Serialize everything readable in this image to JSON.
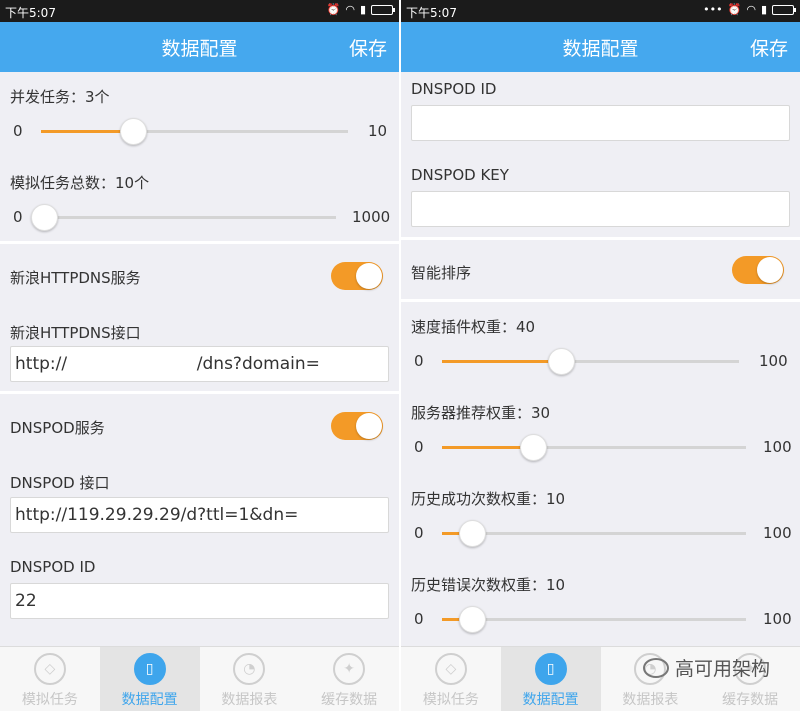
{
  "accent_color": "#45a8ee",
  "slider_color": "#f39a27",
  "left": {
    "status": {
      "time": "下午5:07",
      "icons": [
        "alarm-icon",
        "wifi-icon",
        "signal-icon",
        "battery-icon"
      ]
    },
    "title": "数据配置",
    "save": "保存",
    "concurrent": {
      "label": "并发任务：3个",
      "min": "0",
      "max": "10",
      "value": 3,
      "range": [
        0,
        10
      ]
    },
    "total": {
      "label": "模拟任务总数：10个",
      "min": "0",
      "max": "1000",
      "value": 10,
      "range": [
        0,
        1000
      ]
    },
    "sina_service": {
      "label": "新浪HTTPDNS服务",
      "enabled": true
    },
    "sina_endpoint": {
      "label": "新浪HTTPDNS接口",
      "value": "http://                        /dns?domain="
    },
    "dnspod_service": {
      "label": "DNSPOD服务",
      "enabled": true
    },
    "dnspod_endpoint": {
      "label": "DNSPOD 接口",
      "value": "http://119.29.29.29/d?ttl=1&dn="
    },
    "dnspod_id": {
      "label": "DNSPOD ID",
      "value": "22"
    }
  },
  "right": {
    "status": {
      "time": "下午5:07",
      "icons": [
        "more-icon",
        "alarm-icon",
        "wifi-icon",
        "signal-icon",
        "battery-icon"
      ]
    },
    "title": "数据配置",
    "save": "保存",
    "dnspod_id": {
      "label": "DNSPOD ID",
      "value": ""
    },
    "dnspod_key": {
      "label": "DNSPOD KEY",
      "value": ""
    },
    "smart_sort": {
      "label": "智能排序",
      "enabled": true
    },
    "speed_weight": {
      "label": "速度插件权重：40",
      "min": "0",
      "max": "100",
      "value": 40,
      "range": [
        0,
        100
      ]
    },
    "server_weight": {
      "label": "服务器推荐权重：30",
      "min": "0",
      "max": "100",
      "value": 30,
      "range": [
        0,
        100
      ]
    },
    "success_weight": {
      "label": "历史成功次数权重：10",
      "min": "0",
      "max": "100",
      "value": 10,
      "range": [
        0,
        100
      ]
    },
    "error_weight": {
      "label": "历史错误次数权重：10",
      "min": "0",
      "max": "100",
      "value": 10,
      "range": [
        0,
        100
      ]
    }
  },
  "tabs": [
    {
      "label": "模拟任务",
      "icon": "tag-icon",
      "active": false
    },
    {
      "label": "数据配置",
      "icon": "bookmark-icon",
      "active": true
    },
    {
      "label": "数据报表",
      "icon": "pie-chart-icon",
      "active": false
    },
    {
      "label": "缓存数据",
      "icon": "compass-icon",
      "active": false
    }
  ],
  "watermark": {
    "text": "高可用架构",
    "icon": "wechat-icon"
  }
}
